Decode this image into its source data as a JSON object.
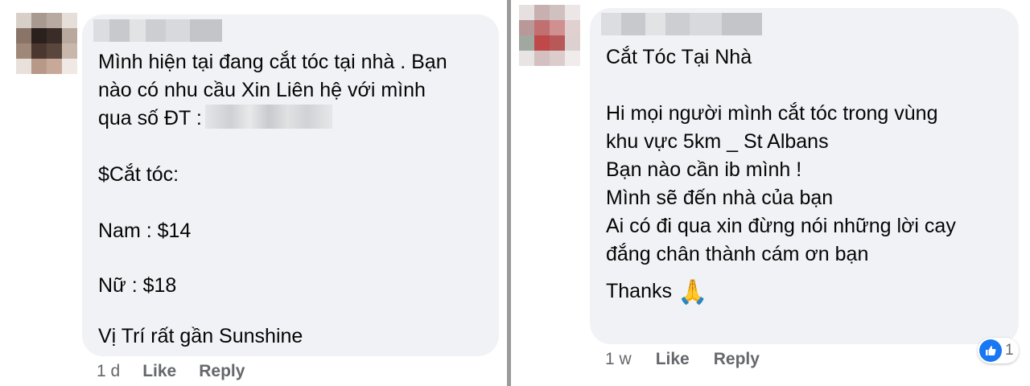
{
  "left_comment": {
    "lines": [
      "Mình hiện tại đang cắt tóc tại nhà . Bạn",
      "nào có nhu cầu Xin Liên hệ với mình",
      "qua số ĐT :",
      "$Cắt tóc:",
      "Nam : $14",
      "Nữ : $18",
      "Vị Trí rất gần Sunshine"
    ],
    "time": "1 d",
    "like": "Like",
    "reply": "Reply"
  },
  "right_comment": {
    "lines": [
      "Cắt Tóc Tại Nhà",
      "Hi mọi người mình cắt tóc trong vùng",
      "khu vực 5km _ St Albans",
      "Bạn nào cần ib mình !",
      "Mình sẽ đến nhà của bạn",
      "Ai có đi qua xin đừng nói những lời cay",
      "đắng chân thành cám ơn bạn",
      "Thanks"
    ],
    "emoji": "🙏",
    "time": "1 w",
    "like": "Like",
    "reply": "Reply",
    "reaction_count": "1"
  },
  "colors": {
    "bubble": "#f0f2f5",
    "meta": "#65676b",
    "like_blue": "#1877f2"
  },
  "icons": [
    "like-icon",
    "folded-hands-emoji"
  ]
}
